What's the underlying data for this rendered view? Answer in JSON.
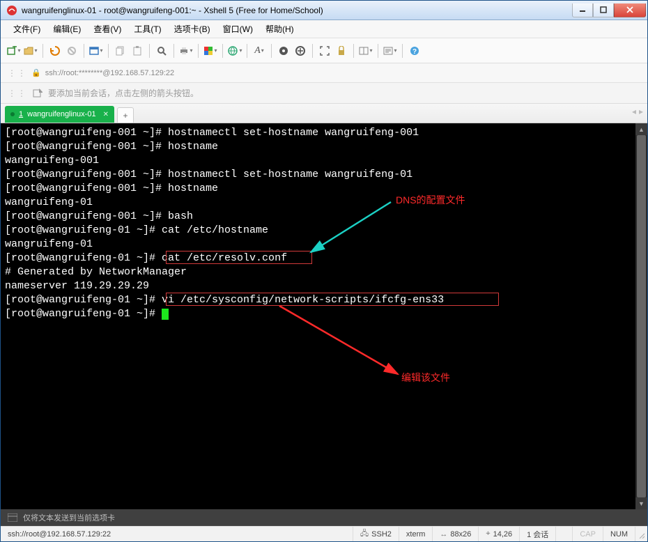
{
  "window": {
    "title": "wangruifenglinux-01 - root@wangruifeng-001:~ - Xshell 5 (Free for Home/School)"
  },
  "menu": {
    "file": "文件(F)",
    "edit": "编辑(E)",
    "view": "查看(V)",
    "tools": "工具(T)",
    "tabs": "选项卡(B)",
    "window": "窗口(W)",
    "help": "帮助(H)"
  },
  "addressbar": {
    "text": "ssh://root:********@192.168.57.129:22"
  },
  "hintbar": {
    "text": "要添加当前会话，点击左侧的箭头按钮。"
  },
  "tab": {
    "index": "1",
    "label": "wangruifenglinux-01",
    "add": "+"
  },
  "terminal": {
    "lines": [
      "[root@wangruifeng-001 ~]# hostnamectl set-hostname wangruifeng-001",
      "[root@wangruifeng-001 ~]# hostname",
      "wangruifeng-001",
      "[root@wangruifeng-001 ~]# hostnamectl set-hostname wangruifeng-01",
      "[root@wangruifeng-001 ~]# hostname",
      "wangruifeng-01",
      "[root@wangruifeng-001 ~]# bash",
      "[root@wangruifeng-01 ~]# cat /etc/hostname",
      "wangruifeng-01",
      "[root@wangruifeng-01 ~]# cat /etc/resolv.conf",
      "# Generated by NetworkManager",
      "nameserver 119.29.29.29",
      "[root@wangruifeng-01 ~]# vi /etc/sysconfig/network-scripts/ifcfg-ens33",
      "[root@wangruifeng-01 ~]# "
    ],
    "box1_text": "cat /etc/resolv.conf",
    "box2_text": "vi /etc/sysconfig/network-scripts/ifcfg-ens33",
    "annotation1": "DNS的配置文件",
    "annotation2": "编辑该文件"
  },
  "footer_hint": {
    "text": "仅将文本发送到当前选项卡"
  },
  "statusbar": {
    "conn": "ssh://root@192.168.57.129:22",
    "ssh": "SSH2",
    "term": "xterm",
    "size": "88x26",
    "pos": "14,26",
    "sessions": "1 会话",
    "caps": "CAP",
    "num": "NUM"
  }
}
